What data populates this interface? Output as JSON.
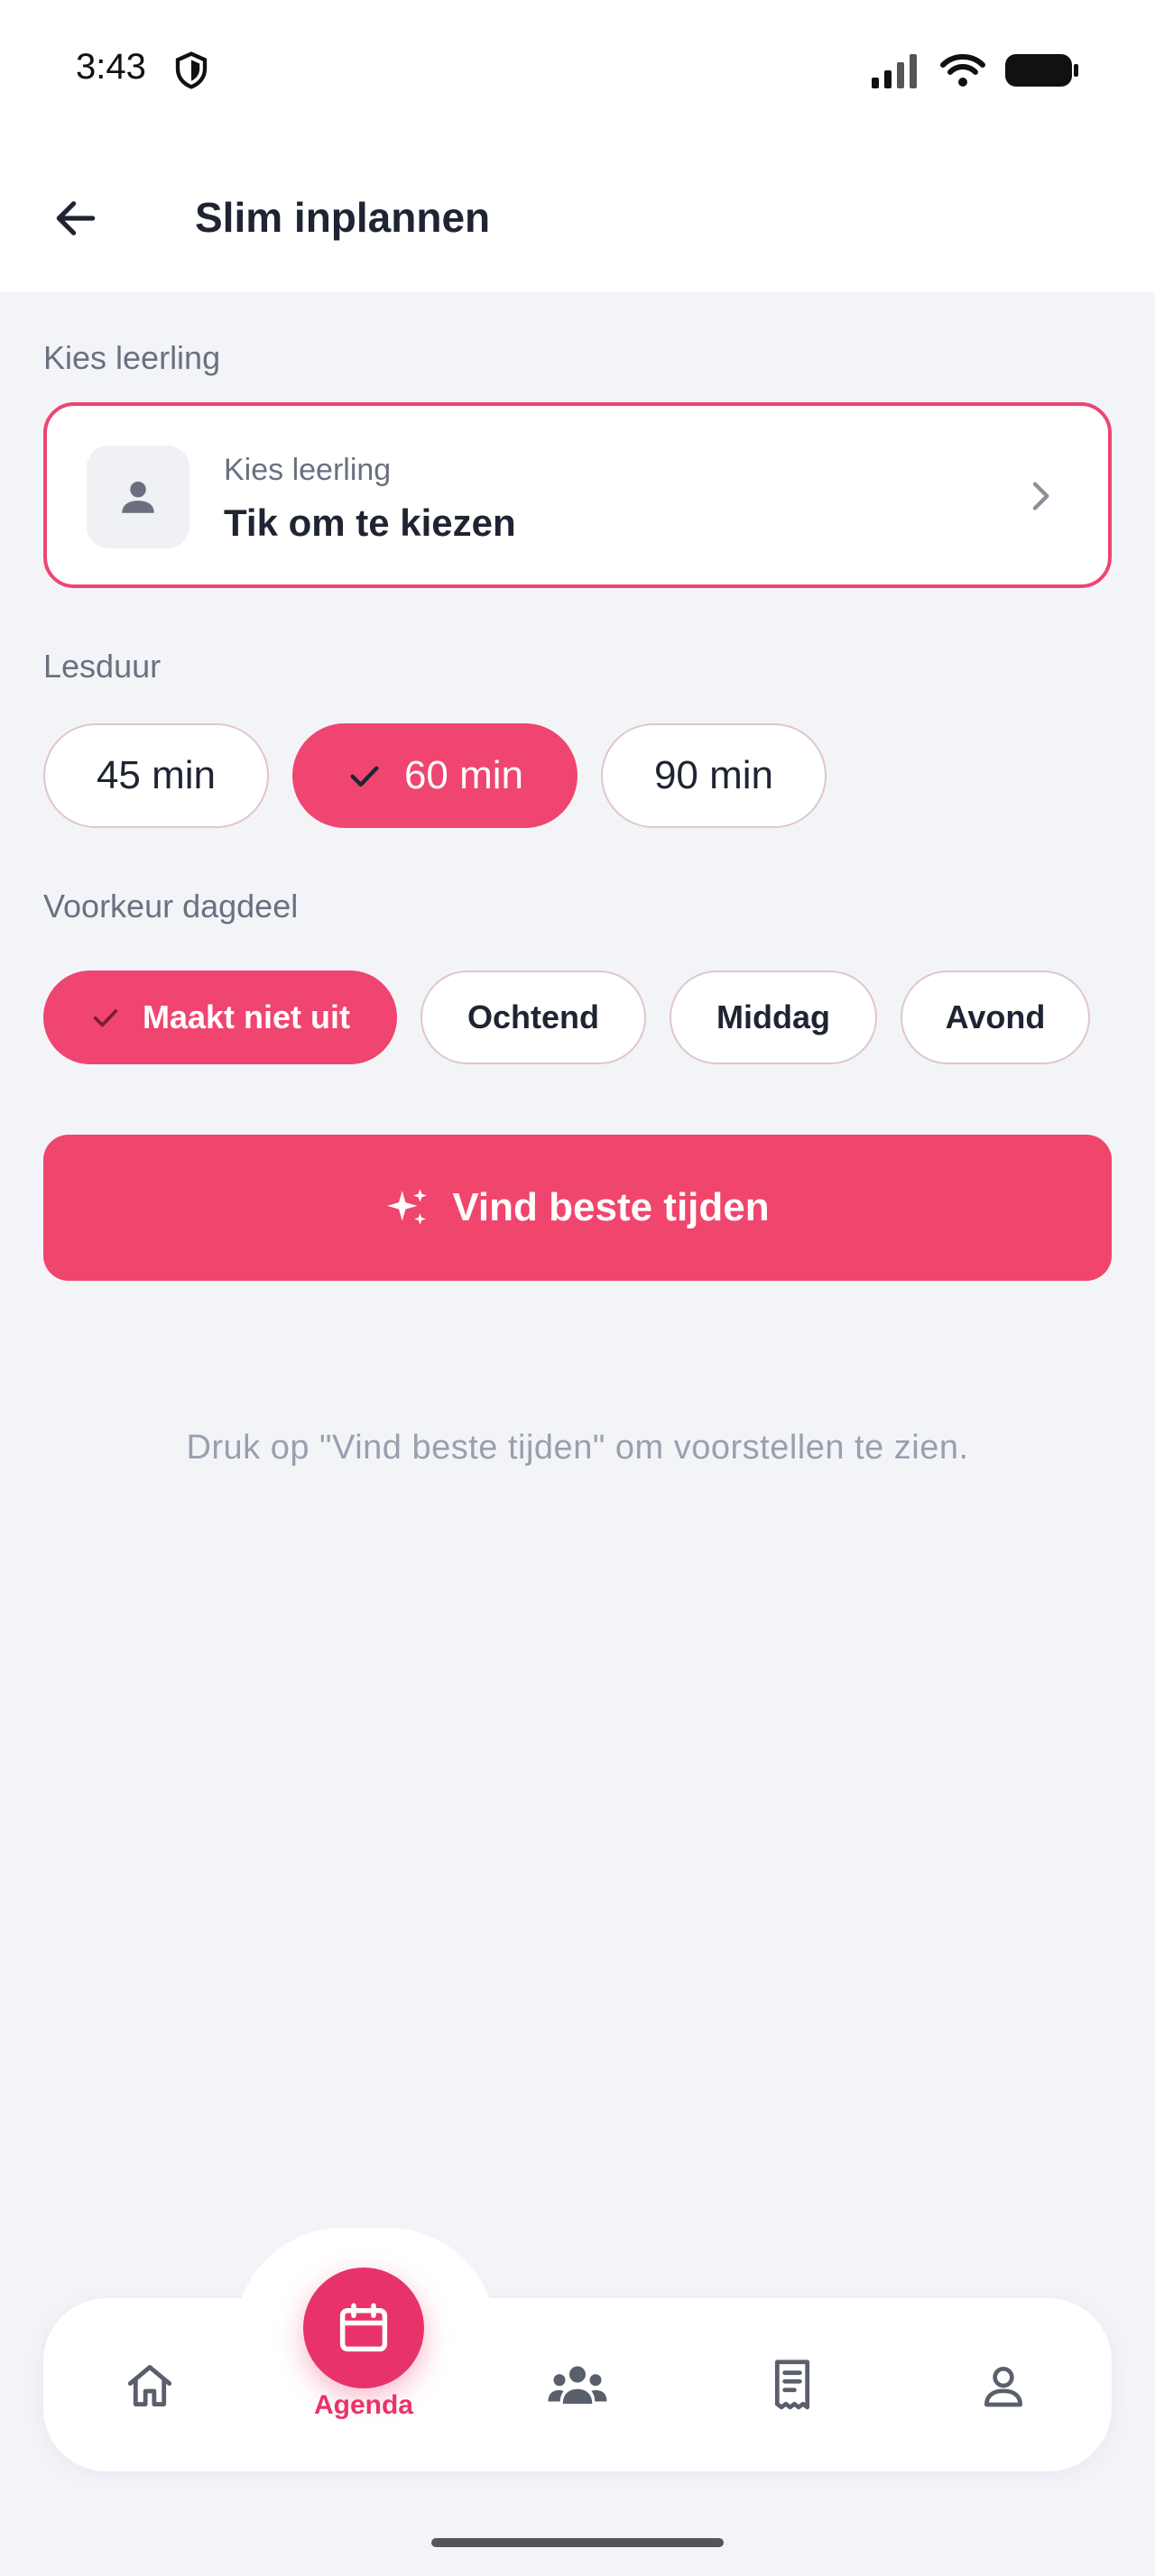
{
  "status": {
    "time": "3:43"
  },
  "header": {
    "title": "Slim inplannen"
  },
  "student": {
    "section_label": "Kies leerling",
    "card_label": "Kies leerling",
    "card_value": "Tik om te kiezen"
  },
  "duration": {
    "section_label": "Lesduur",
    "options": [
      {
        "label": "45 min",
        "selected": false
      },
      {
        "label": "60 min",
        "selected": true
      },
      {
        "label": "90 min",
        "selected": false
      }
    ]
  },
  "daypart": {
    "section_label": "Voorkeur dagdeel",
    "options": [
      {
        "label": "Maakt niet uit",
        "selected": true
      },
      {
        "label": "Ochtend",
        "selected": false
      },
      {
        "label": "Middag",
        "selected": false
      },
      {
        "label": "Avond",
        "selected": false
      }
    ]
  },
  "cta": {
    "label": "Vind beste tijden"
  },
  "hint": "Druk op \"Vind beste tijden\" om voorstellen te zien.",
  "tabbar": {
    "items": [
      {
        "icon": "home-icon"
      },
      {
        "icon": "calendar-icon",
        "label": "Agenda",
        "active": true
      },
      {
        "icon": "groups-icon"
      },
      {
        "icon": "receipt-icon"
      },
      {
        "icon": "profile-icon"
      }
    ]
  },
  "colors": {
    "accent": "#ef4570",
    "accent_dark": "#e8336a",
    "background": "#f3f4f8"
  }
}
